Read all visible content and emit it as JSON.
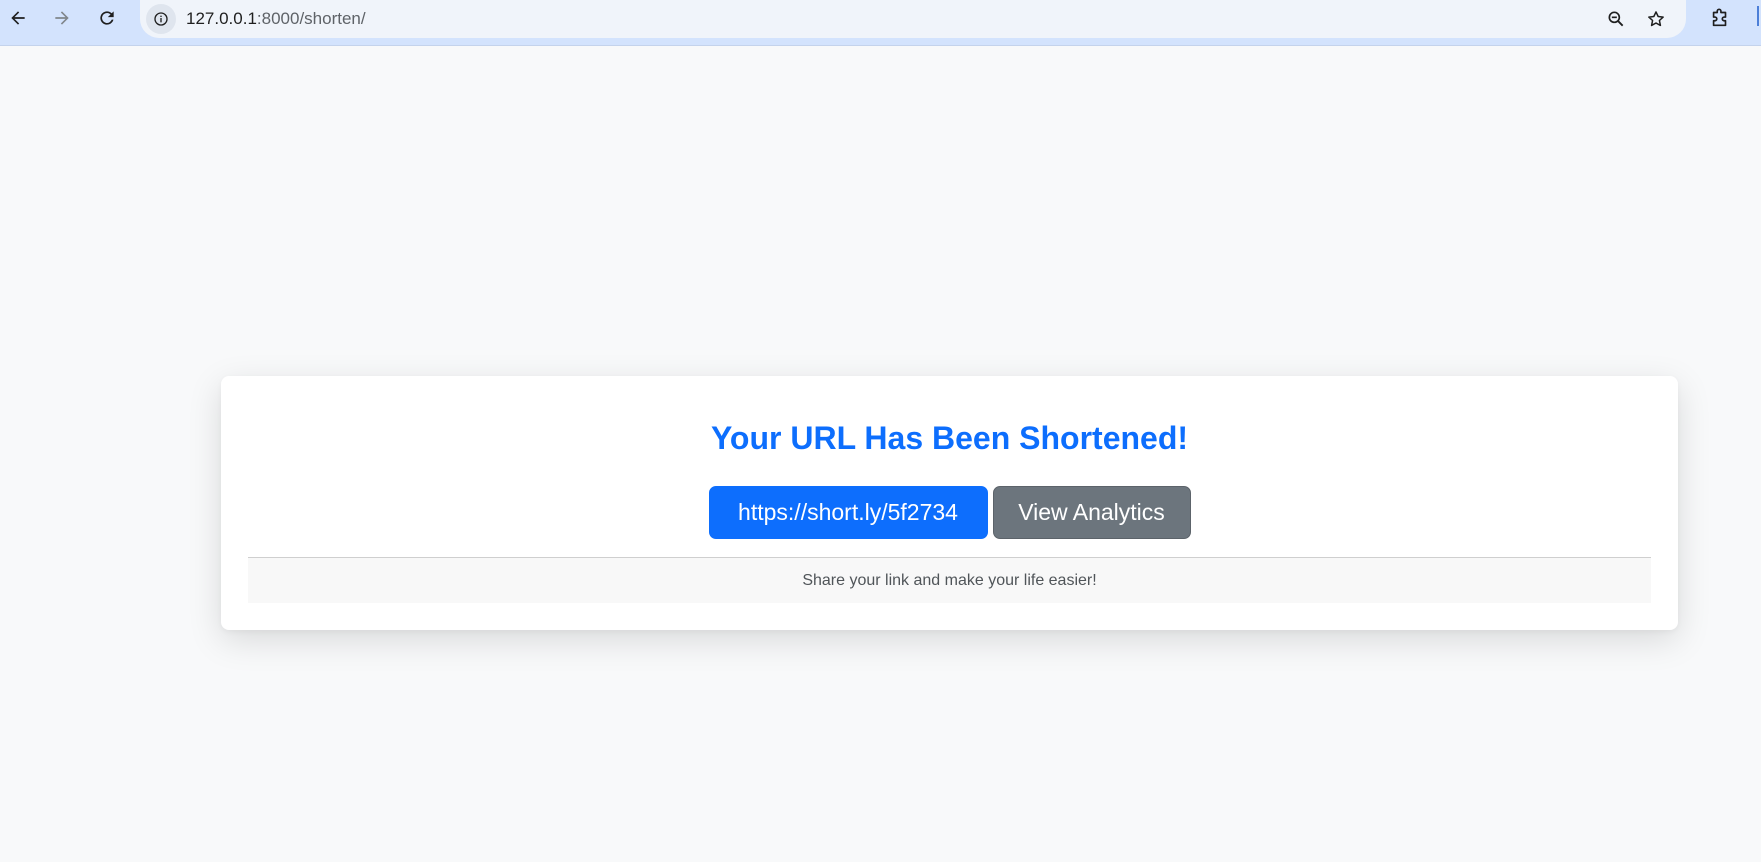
{
  "browser": {
    "url_host": "127.0.0.1",
    "url_path": ":8000/shorten/",
    "icons": {
      "back": "arrow-left-icon",
      "forward": "arrow-right-icon",
      "reload": "reload-icon",
      "site_info": "info-icon",
      "zoom": "zoom-out-icon",
      "bookmark": "star-icon",
      "extensions": "puzzle-icon"
    }
  },
  "card": {
    "title": "Your URL Has Been Shortened!",
    "short_url_label": "https://short.ly/5f2734",
    "analytics_label": "View Analytics",
    "footer_text": "Share your link and make your life easier!"
  },
  "colors": {
    "primary": "#0d6efd",
    "secondary": "#6c757d",
    "page_background": "#f8f9fa",
    "toolbar_background": "#d3e3fd"
  }
}
